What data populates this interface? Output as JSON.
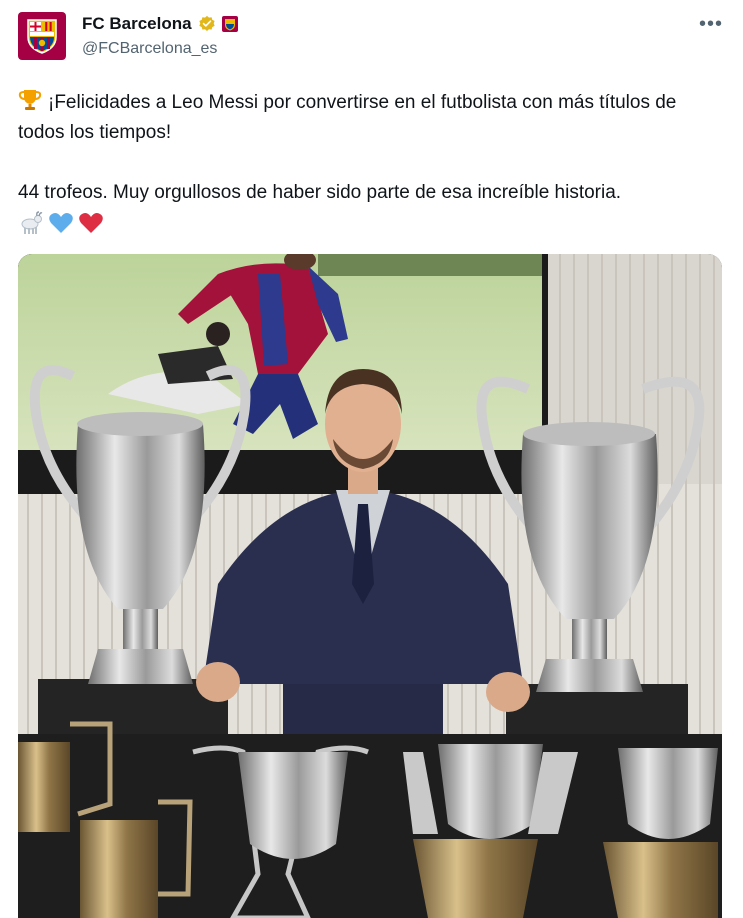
{
  "account": {
    "name": "FC Barcelona",
    "handle": "@FCBarcelona_es",
    "verified": true,
    "avatar_icon": "fcb-crest-icon",
    "affiliate_icon": "fcb-mini-badge-icon"
  },
  "menu": {
    "more_icon": "more-icon"
  },
  "tweet": {
    "line1_prefix_icon": "trophy-icon",
    "line1": "¡Felicidades a Leo Messi por convertirse en el futbolista con más títulos de todos los tiempos!",
    "line2": "44 trofeos. Muy orgullosos de haber sido parte de esa increíble historia.",
    "trailing_icons": [
      "goat-icon",
      "blue-heart-icon",
      "red-heart-icon"
    ]
  },
  "colors": {
    "brand": "#a50044",
    "brand_blue": "#004d98",
    "gold": "#edbb00",
    "text": "#0f1419",
    "secondary": "#536471"
  }
}
